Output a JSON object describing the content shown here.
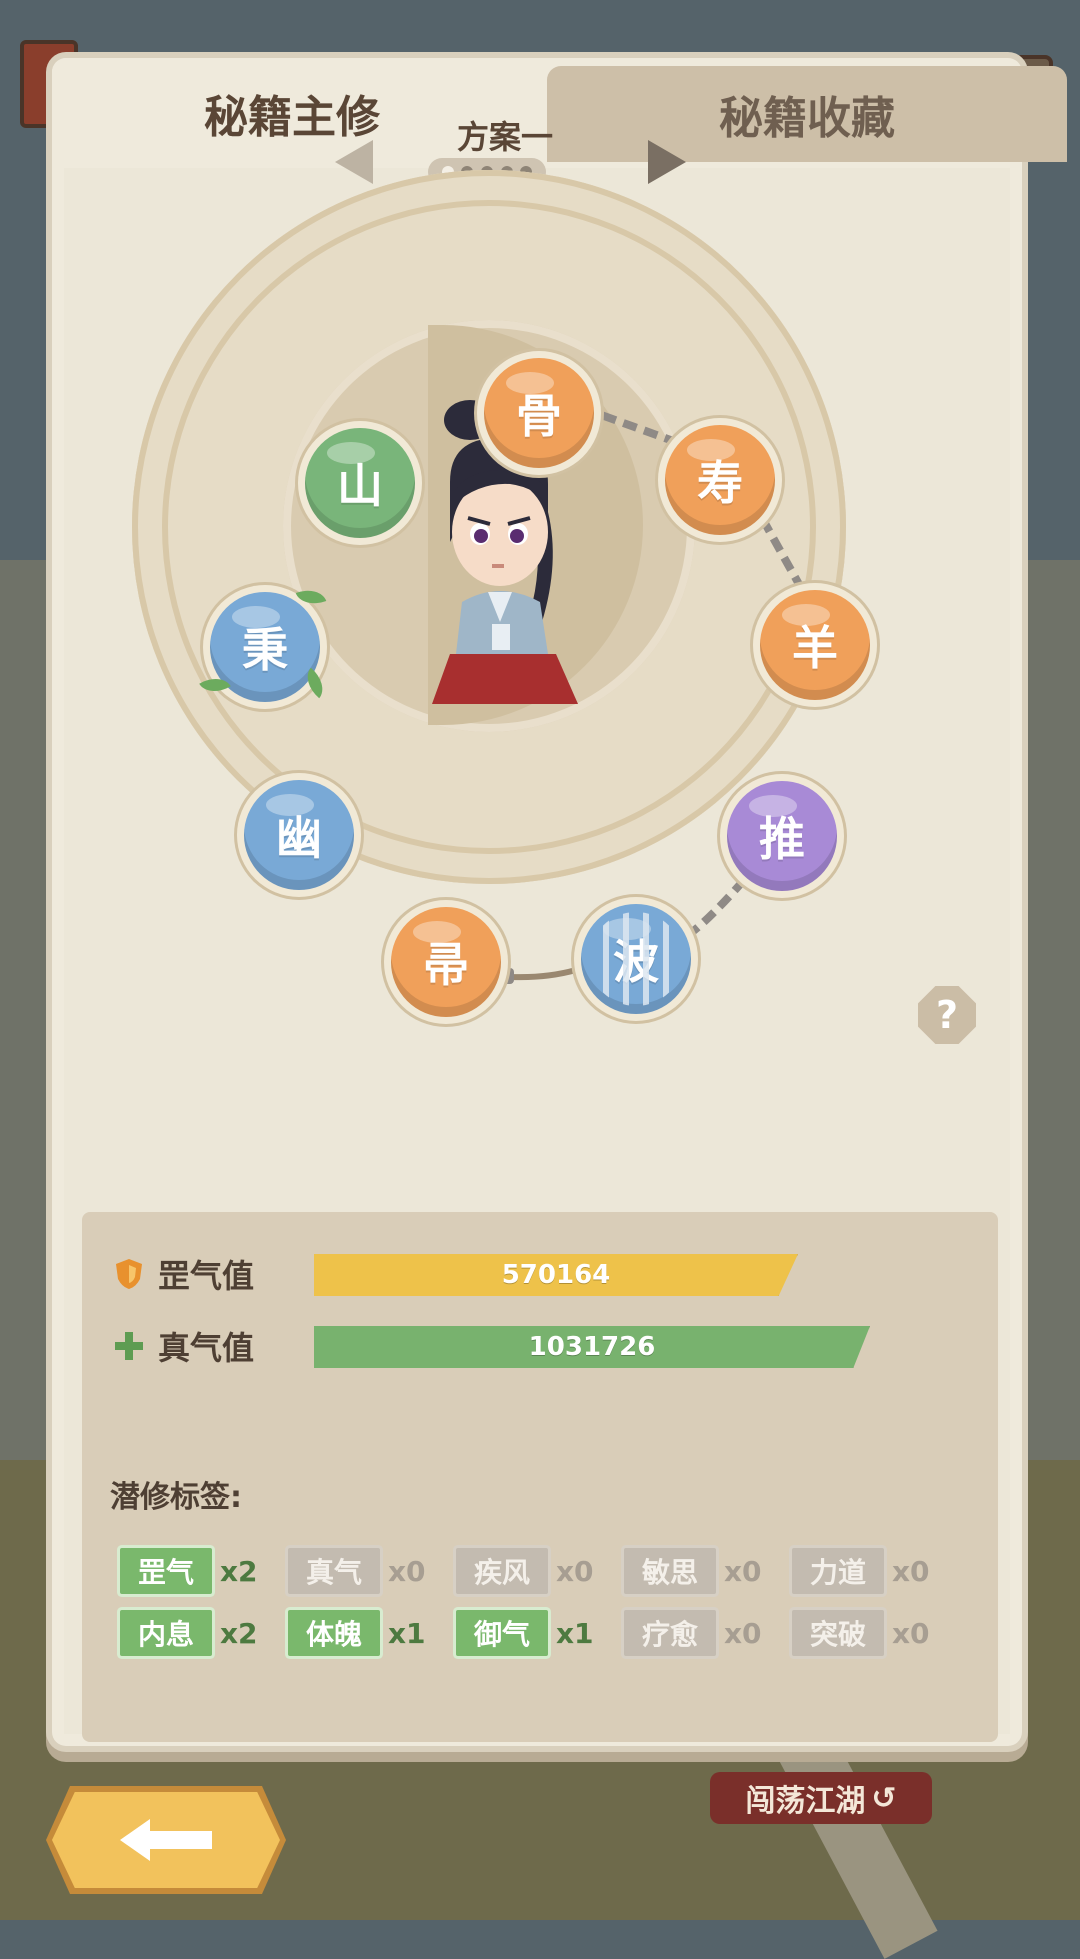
{
  "tabs": {
    "active": "秘籍主修",
    "inactive": "秘籍收藏"
  },
  "plan": {
    "name": "方案一",
    "total": 5,
    "selected_index": 0
  },
  "wheel": {
    "skills": [
      {
        "char": "骨",
        "color": "orange",
        "state": "chained"
      },
      {
        "char": "寿",
        "color": "orange",
        "state": "chained"
      },
      {
        "char": "羊",
        "color": "orange",
        "state": "chained"
      },
      {
        "char": "推",
        "color": "purple",
        "state": "chained"
      },
      {
        "char": "波",
        "color": "blue",
        "state": "locked"
      },
      {
        "char": "帚",
        "color": "orange",
        "state": "chained"
      },
      {
        "char": "幽",
        "color": "blue",
        "state": "normal"
      },
      {
        "char": "秉",
        "color": "blue",
        "state": "leaf"
      },
      {
        "char": "山",
        "color": "green",
        "state": "normal"
      }
    ]
  },
  "help": {
    "icon": "?"
  },
  "stats": {
    "gang": {
      "label": "罡气值",
      "value": "570164",
      "icon": "shield-icon",
      "color": "#eec24a"
    },
    "zhen": {
      "label": "真气值",
      "value": "1031726",
      "icon": "plus-icon",
      "color": "#78b26e"
    }
  },
  "tags_title": "潜修标签:",
  "tags": [
    {
      "label": "罡气",
      "count": "x2",
      "active": true
    },
    {
      "label": "真气",
      "count": "x0",
      "active": false
    },
    {
      "label": "疾风",
      "count": "x0",
      "active": false
    },
    {
      "label": "敏思",
      "count": "x0",
      "active": false
    },
    {
      "label": "力道",
      "count": "x0",
      "active": false
    },
    {
      "label": "内息",
      "count": "x2",
      "active": true
    },
    {
      "label": "体魄",
      "count": "x1",
      "active": true
    },
    {
      "label": "御气",
      "count": "x1",
      "active": true
    },
    {
      "label": "疗愈",
      "count": "x0",
      "active": false
    },
    {
      "label": "突破",
      "count": "x0",
      "active": false
    }
  ],
  "bottom": {
    "back_icon": "arrow-left-icon",
    "roam_label": "闯荡江湖"
  }
}
